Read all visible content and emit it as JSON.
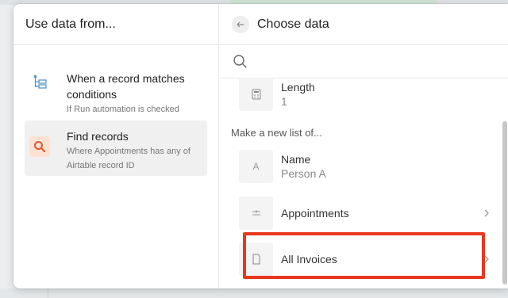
{
  "left": {
    "title": "Use data from...",
    "options": [
      {
        "title": "When a record matches conditions",
        "subtitle": "If Run automation is checked",
        "icon": "trigger-condition-icon"
      },
      {
        "title": "Find records",
        "subtitle": "Where Appointments has any of Airtable record ID",
        "icon": "search-icon",
        "selected": true
      }
    ]
  },
  "right": {
    "title": "Choose data",
    "back_icon": "arrow-left-icon",
    "search_placeholder": "",
    "top_field": {
      "name": "Length",
      "value": "1",
      "icon": "calculator-icon"
    },
    "section_label": "Make a new list of...",
    "fields": [
      {
        "name": "Name",
        "value": "Person A",
        "icon": "text-a-icon"
      },
      {
        "name": "Appointments",
        "icon": "linked-record-icon",
        "has_chevron": true
      },
      {
        "name": "All Invoices",
        "icon": "document-icon",
        "has_chevron": true,
        "highlighted": true
      }
    ]
  },
  "colors": {
    "highlight": "#e8381e",
    "selected_bg": "#f0f0f0",
    "search_badge_bg": "#fde2d3",
    "search_badge_icon": "#e4572e"
  }
}
